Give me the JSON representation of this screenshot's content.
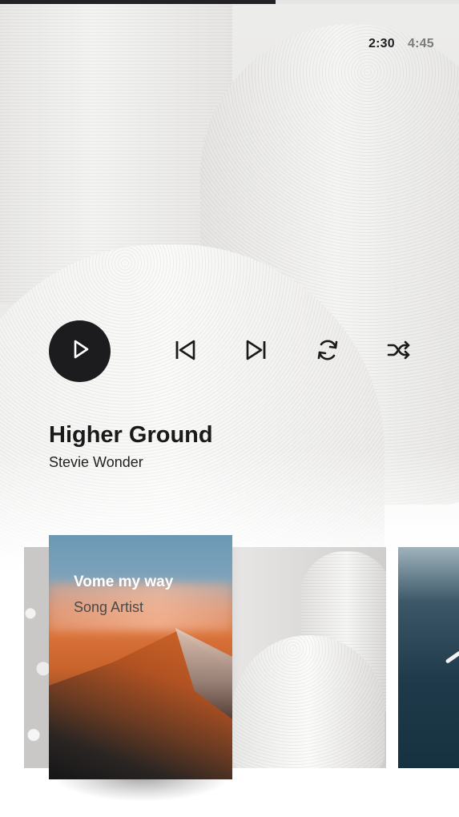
{
  "player": {
    "progress": 0.6,
    "time_current": "2:30",
    "time_total": "4:45",
    "track": {
      "title": "Higher Ground",
      "artist": "Stevie Wonder"
    },
    "controls": [
      "play-icon",
      "previous-icon",
      "next-icon",
      "repeat-icon",
      "shuffle-icon"
    ]
  },
  "carousel": {
    "cards": [
      {
        "title": "Vome my way",
        "artist": "Song Artist"
      }
    ]
  },
  "colors": {
    "accent_dark": "#1c1c1e",
    "progress_fill": "#222226",
    "progress_track": "#e5e5e5",
    "time_secondary": "#7a7a7a"
  }
}
